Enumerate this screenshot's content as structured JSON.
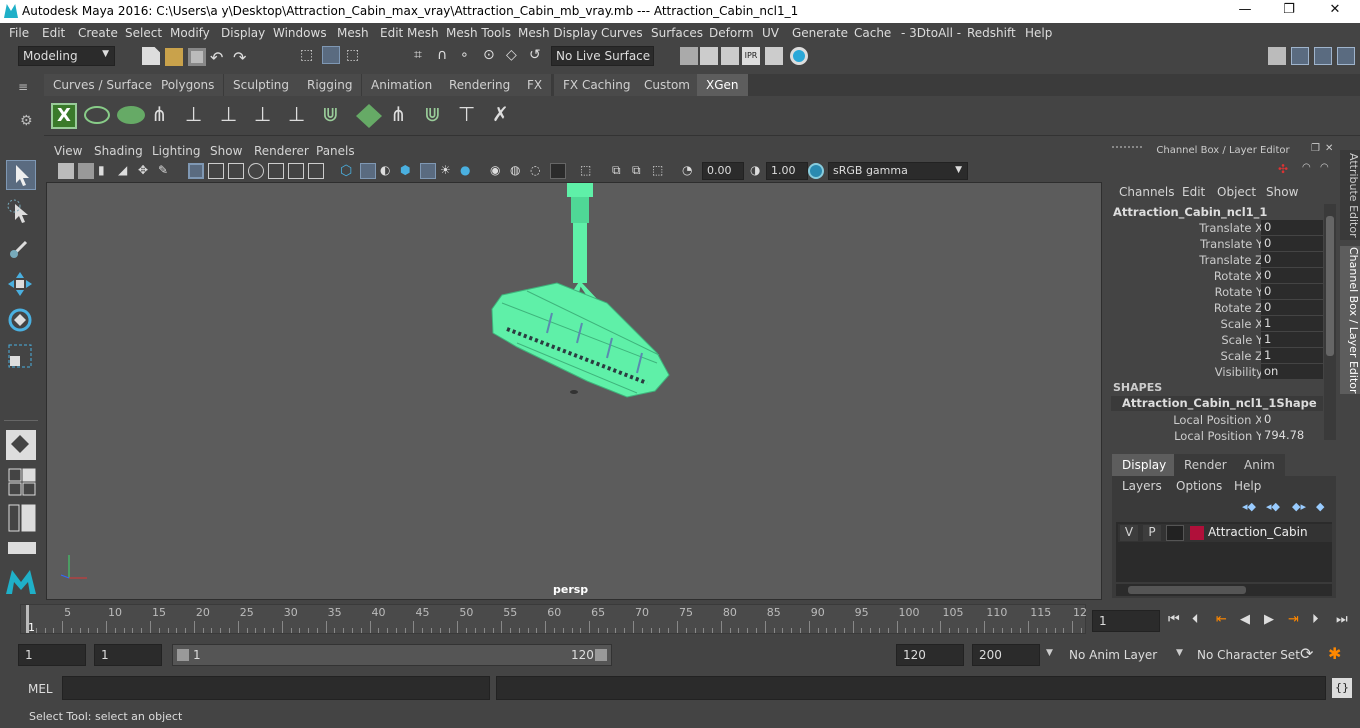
{
  "window": {
    "title": "Autodesk Maya 2016: C:\\Users\\a y\\Desktop\\Attraction_Cabin_max_vray\\Attraction_Cabin_mb_vray.mb   ---   Attraction_Cabin_ncl1_1",
    "minimize": "—",
    "maximize": "❐",
    "close": "✕"
  },
  "menubar": [
    "File",
    "Edit",
    "Create",
    "Select",
    "Modify",
    "Display",
    "Windows",
    "Mesh",
    "Edit Mesh",
    "Mesh Tools",
    "Mesh Display",
    "Curves",
    "Surfaces",
    "Deform",
    "UV",
    "Generate",
    "Cache",
    "- 3DtoAll -",
    "Redshift",
    "Help"
  ],
  "statusline": {
    "mode": "Modeling",
    "live_surface": "No Live Surface"
  },
  "shelf_tabs": [
    "Curves / Surfaces",
    "Polygons",
    "Sculpting",
    "Rigging",
    "Animation",
    "Rendering",
    "FX",
    "FX Caching",
    "Custom",
    "XGen"
  ],
  "active_shelf": "XGen",
  "panel_menu": [
    "View",
    "Shading",
    "Lighting",
    "Show",
    "Renderer",
    "Panels"
  ],
  "panel_toolbar": {
    "exposure": "0.00",
    "gamma": "1.00",
    "color_space": "sRGB gamma"
  },
  "viewport": {
    "camera_label": "persp",
    "model_color": "#5ff0a8"
  },
  "channel_box": {
    "title": "Channel Box / Layer Editor",
    "menu": [
      "Channels",
      "Edit",
      "Object",
      "Show"
    ],
    "object_name": "Attraction_Cabin_ncl1_1",
    "attributes": [
      {
        "label": "Translate X",
        "value": "0"
      },
      {
        "label": "Translate Y",
        "value": "0"
      },
      {
        "label": "Translate Z",
        "value": "0"
      },
      {
        "label": "Rotate X",
        "value": "0"
      },
      {
        "label": "Rotate Y",
        "value": "0"
      },
      {
        "label": "Rotate Z",
        "value": "0"
      },
      {
        "label": "Scale X",
        "value": "1"
      },
      {
        "label": "Scale Y",
        "value": "1"
      },
      {
        "label": "Scale Z",
        "value": "1"
      },
      {
        "label": "Visibility",
        "value": "on"
      }
    ],
    "shapes_header": "SHAPES",
    "shape_name": "Attraction_Cabin_ncl1_1Shape",
    "shape_attributes": [
      {
        "label": "Local Position X",
        "value": "0"
      },
      {
        "label": "Local Position Y",
        "value": "794.78"
      }
    ]
  },
  "side_tabs": {
    "attribute_editor": "Attribute Editor",
    "channel_box": "Channel Box / Layer Editor"
  },
  "layer_editor": {
    "tabs": [
      "Display",
      "Render",
      "Anim"
    ],
    "menu": [
      "Layers",
      "Options",
      "Help"
    ],
    "layer": {
      "v": "V",
      "p": "P",
      "name": "Attraction_Cabin",
      "color": "#b0103a"
    }
  },
  "timeline": {
    "ticks": [
      "1",
      "5",
      "10",
      "15",
      "20",
      "25",
      "30",
      "35",
      "40",
      "45",
      "50",
      "55",
      "60",
      "65",
      "70",
      "75",
      "80",
      "85",
      "90",
      "95",
      "100",
      "105",
      "110",
      "115",
      "12"
    ],
    "current_frame": "1"
  },
  "range": {
    "start": "1",
    "playback_start": "1",
    "slider_start": "1",
    "slider_end": "120",
    "playback_end": "120",
    "end": "200",
    "anim_layer": "No Anim Layer",
    "character_set": "No Character Set"
  },
  "command_line": {
    "label": "MEL"
  },
  "help_line": "Select Tool: select an object"
}
